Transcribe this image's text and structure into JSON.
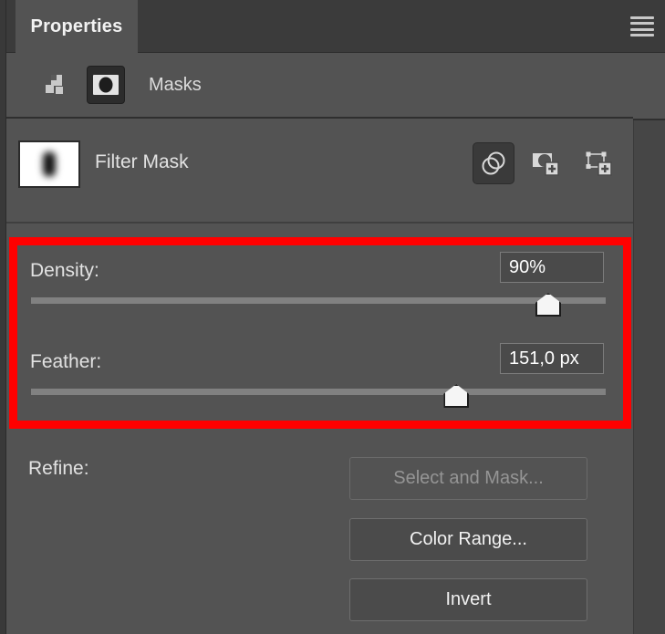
{
  "panel": {
    "tab_label": "Properties",
    "menu_icon": "hamburger-menu-icon"
  },
  "mode_bar": {
    "title": "Masks",
    "icons": [
      {
        "name": "pixel-layer-icon",
        "active": false
      },
      {
        "name": "layer-mask-icon",
        "active": true
      }
    ]
  },
  "mask_row": {
    "title": "Filter Mask",
    "thumbnail": "filter-mask-thumbnail",
    "actions": [
      {
        "name": "select-mask-icon",
        "selected": true
      },
      {
        "name": "add-pixel-mask-icon",
        "selected": false
      },
      {
        "name": "add-vector-mask-icon",
        "selected": false
      }
    ]
  },
  "controls": {
    "density": {
      "label": "Density:",
      "value": "90%",
      "slider_percent": 90
    },
    "feather": {
      "label": "Feather:",
      "value": "151,0 px",
      "slider_percent": 74
    }
  },
  "refine": {
    "label": "Refine:",
    "buttons": [
      {
        "label": "Select and Mask...",
        "enabled": false
      },
      {
        "label": "Color Range...",
        "enabled": true
      },
      {
        "label": "Invert",
        "enabled": true
      }
    ]
  },
  "annotation": {
    "color": "#ff0000",
    "name": "red-highlight-rectangle"
  }
}
